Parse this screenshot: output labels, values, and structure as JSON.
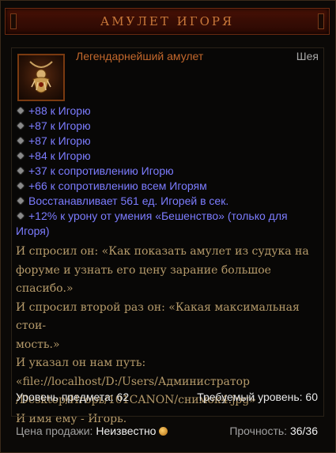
{
  "tooltip": {
    "title": "АМУЛЕТ ИГОРЯ",
    "item_type": "Легендарнейший амулет",
    "slot": "Шея",
    "icon": "amulet-icon",
    "affixes": [
      "+88 к Игорю",
      "+87 к Игорю",
      "+87 к Игорю",
      "+84 к Игорю",
      "+37 к сопротивлению Игорю",
      "+66 к сопротивлению всем Игорям",
      "Восстанавливает 561 ед. Игорей в сек.",
      "+12% к урону от умения «Бешенство» (только для Игоря)"
    ],
    "flavor": [
      "И спросил он: «Как показать амулет из судука на",
      "форуме и узнать его цену зарание большое спасибо.»",
      "И спросил второй раз он: «Какая максимальная стои-",
      "мость.»",
      "И указал он нам путь:",
      "«file://localhost/D:/Users/Администратор",
      "/Desktop/Игорь/101CANON/снимок4.jpg»",
      "И имя ему - Игорь."
    ],
    "item_level_label": "Уровень предмета: 62",
    "required_level_label": "Требуемый уровень: 60",
    "sell_price_label": "Цена продажи:",
    "sell_price_value": "Неизвестно",
    "durability_label": "Прочность:",
    "durability_value": "36/36"
  },
  "colors": {
    "title": "#c9783a",
    "legendary": "#c4682c",
    "magic_affix": "#7c7cff",
    "flavor": "#b59a6a"
  }
}
